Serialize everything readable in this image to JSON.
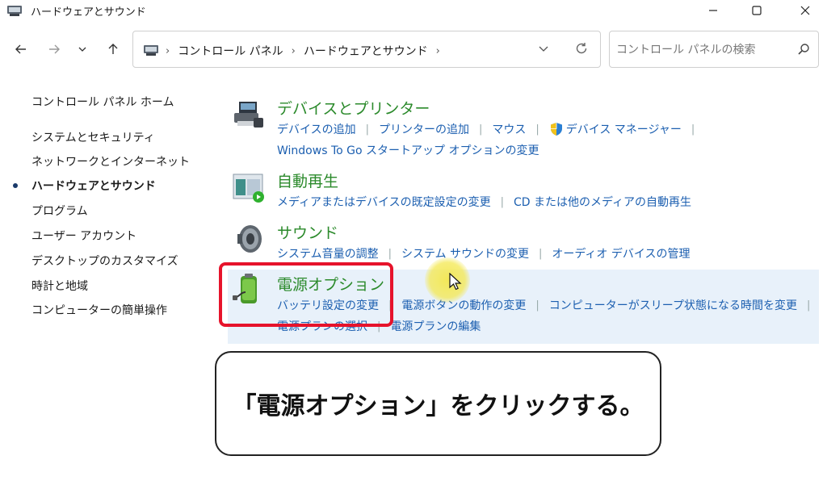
{
  "window": {
    "title": "ハードウェアとサウンド"
  },
  "nav": {
    "breadcrumbs": [
      "コントロール パネル",
      "ハードウェアとサウンド"
    ],
    "search_placeholder": "コントロール パネルの検索"
  },
  "sidebar": {
    "home": "コントロール パネル ホーム",
    "items": [
      {
        "label": "システムとセキュリティ"
      },
      {
        "label": "ネットワークとインターネット"
      },
      {
        "label": "ハードウェアとサウンド",
        "active": true
      },
      {
        "label": "プログラム"
      },
      {
        "label": "ユーザー アカウント"
      },
      {
        "label": "デスクトップのカスタマイズ"
      },
      {
        "label": "時計と地域"
      },
      {
        "label": "コンピューターの簡単操作"
      }
    ]
  },
  "categories": {
    "devices": {
      "title": "デバイスとプリンター",
      "links": [
        "デバイスの追加",
        "プリンターの追加",
        "マウス",
        "デバイス マネージャー"
      ],
      "links2": [
        "Windows To Go スタートアップ オプションの変更"
      ],
      "icon": "printer-icon"
    },
    "autoplay": {
      "title": "自動再生",
      "links": [
        "メディアまたはデバイスの既定設定の変更",
        "CD または他のメディアの自動再生"
      ],
      "icon": "autoplay-icon"
    },
    "sound": {
      "title": "サウンド",
      "links": [
        "システム音量の調整",
        "システム サウンドの変更",
        "オーディオ デバイスの管理"
      ],
      "icon": "speaker-icon"
    },
    "power": {
      "title": "電源オプション",
      "links": [
        "バッテリ設定の変更",
        "電源ボタンの動作の変更",
        "コンピューターがスリープ状態になる時間を変更"
      ],
      "links2": [
        "電源プランの選択",
        "電源プランの編集"
      ],
      "icon": "battery-icon"
    }
  },
  "caption": {
    "text": "「電源オプション」をクリックする。"
  },
  "colors": {
    "link": "#1c5fb0",
    "category_title": "#2b8a2b",
    "highlight_frame": "#e6132b",
    "hover_background": "#e8f1fa"
  }
}
